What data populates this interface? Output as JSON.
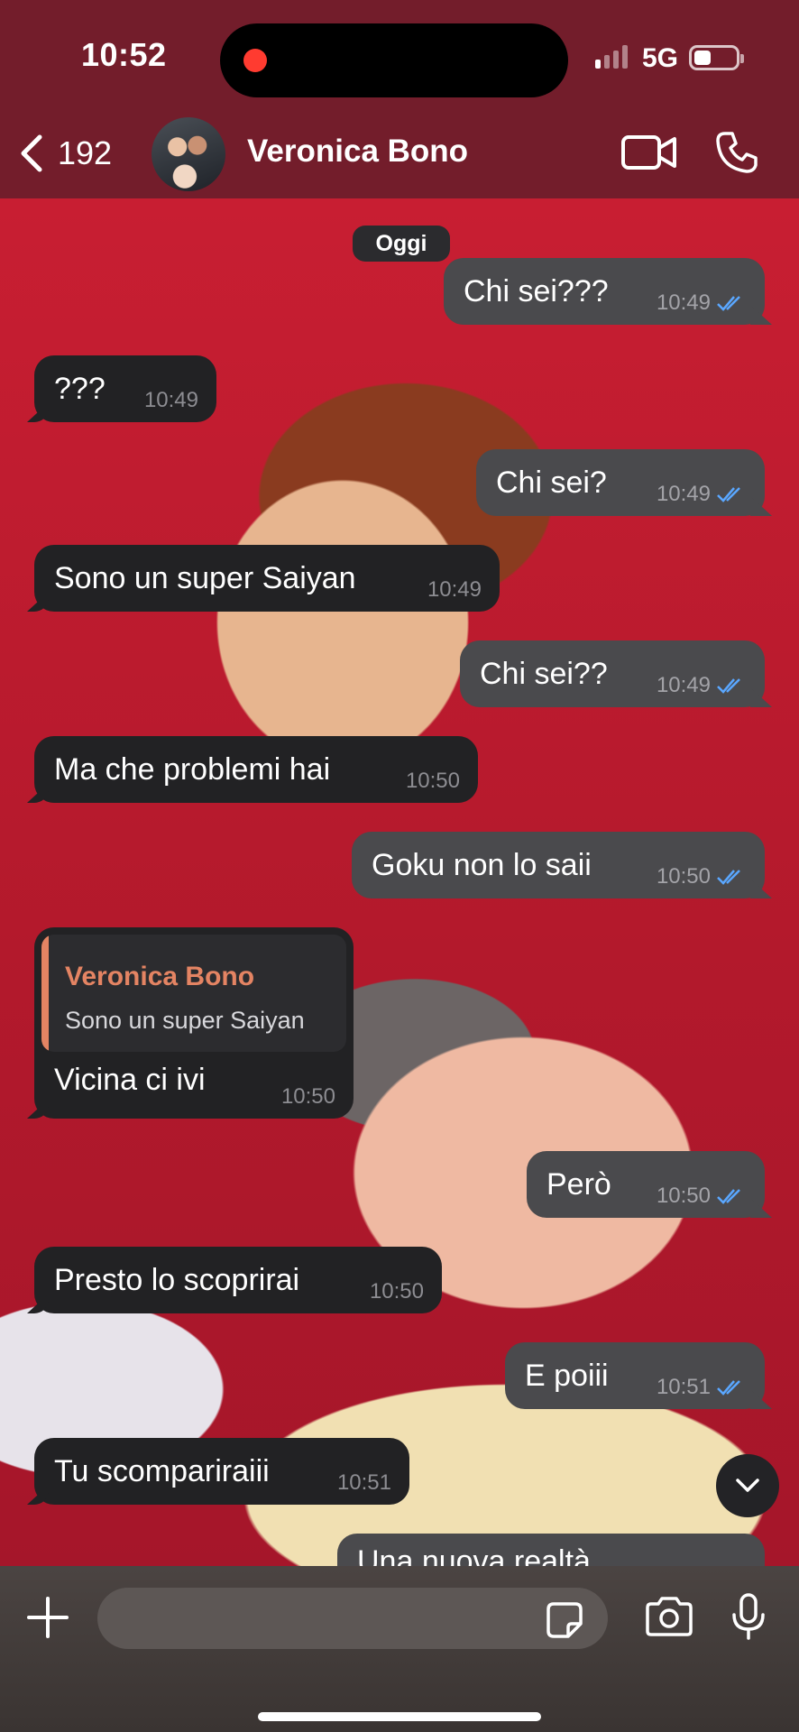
{
  "status_bar": {
    "time": "10:52",
    "network": "5G"
  },
  "header": {
    "back_count": "192",
    "contact_name": "Veronica Bono"
  },
  "chat": {
    "date_label": "Oggi",
    "messages": [
      {
        "text": "Chi sei???",
        "time": "10:49",
        "dir": "out",
        "read": true
      },
      {
        "text": "???",
        "time": "10:49",
        "dir": "in"
      },
      {
        "text": "Chi sei?",
        "time": "10:49",
        "dir": "out",
        "read": true
      },
      {
        "text": "Sono un super Saiyan",
        "time": "10:49",
        "dir": "in"
      },
      {
        "text": "Chi sei??",
        "time": "10:49",
        "dir": "out",
        "read": true
      },
      {
        "text": "Ma che problemi hai",
        "time": "10:50",
        "dir": "in"
      },
      {
        "text": "Goku non lo saii",
        "time": "10:50",
        "dir": "out",
        "read": true
      },
      {
        "text": "Vicina ci ivi",
        "time": "10:50",
        "dir": "in",
        "reply_to": {
          "name": "Veronica Bono",
          "text": "Sono un super Saiyan"
        }
      },
      {
        "text": "Però",
        "time": "10:50",
        "dir": "out",
        "read": true
      },
      {
        "text": "Presto lo scoprirai",
        "time": "10:50",
        "dir": "in"
      },
      {
        "text": "E poiii",
        "time": "10:51",
        "dir": "out",
        "read": true
      },
      {
        "text": "Tu scompariraiii",
        "time": "10:51",
        "dir": "in"
      },
      {
        "text": "Una nuova realtà",
        "time": "",
        "dir": "out"
      }
    ]
  },
  "input_bar": {
    "placeholder": ""
  },
  "icons": {
    "back": "chevron-left-icon",
    "video": "video-camera-icon",
    "call": "phone-icon",
    "plus": "plus-icon",
    "sticker": "sticker-icon",
    "camera": "camera-icon",
    "mic": "microphone-icon",
    "scroll": "chevron-down-icon",
    "read": "double-check-icon"
  },
  "colors": {
    "header_bg": "#731d2b",
    "incoming_bubble": "#222224",
    "outgoing_bubble": "#4a4a4d",
    "read_ticks": "#5aa7ff",
    "reply_accent": "#e48463"
  }
}
